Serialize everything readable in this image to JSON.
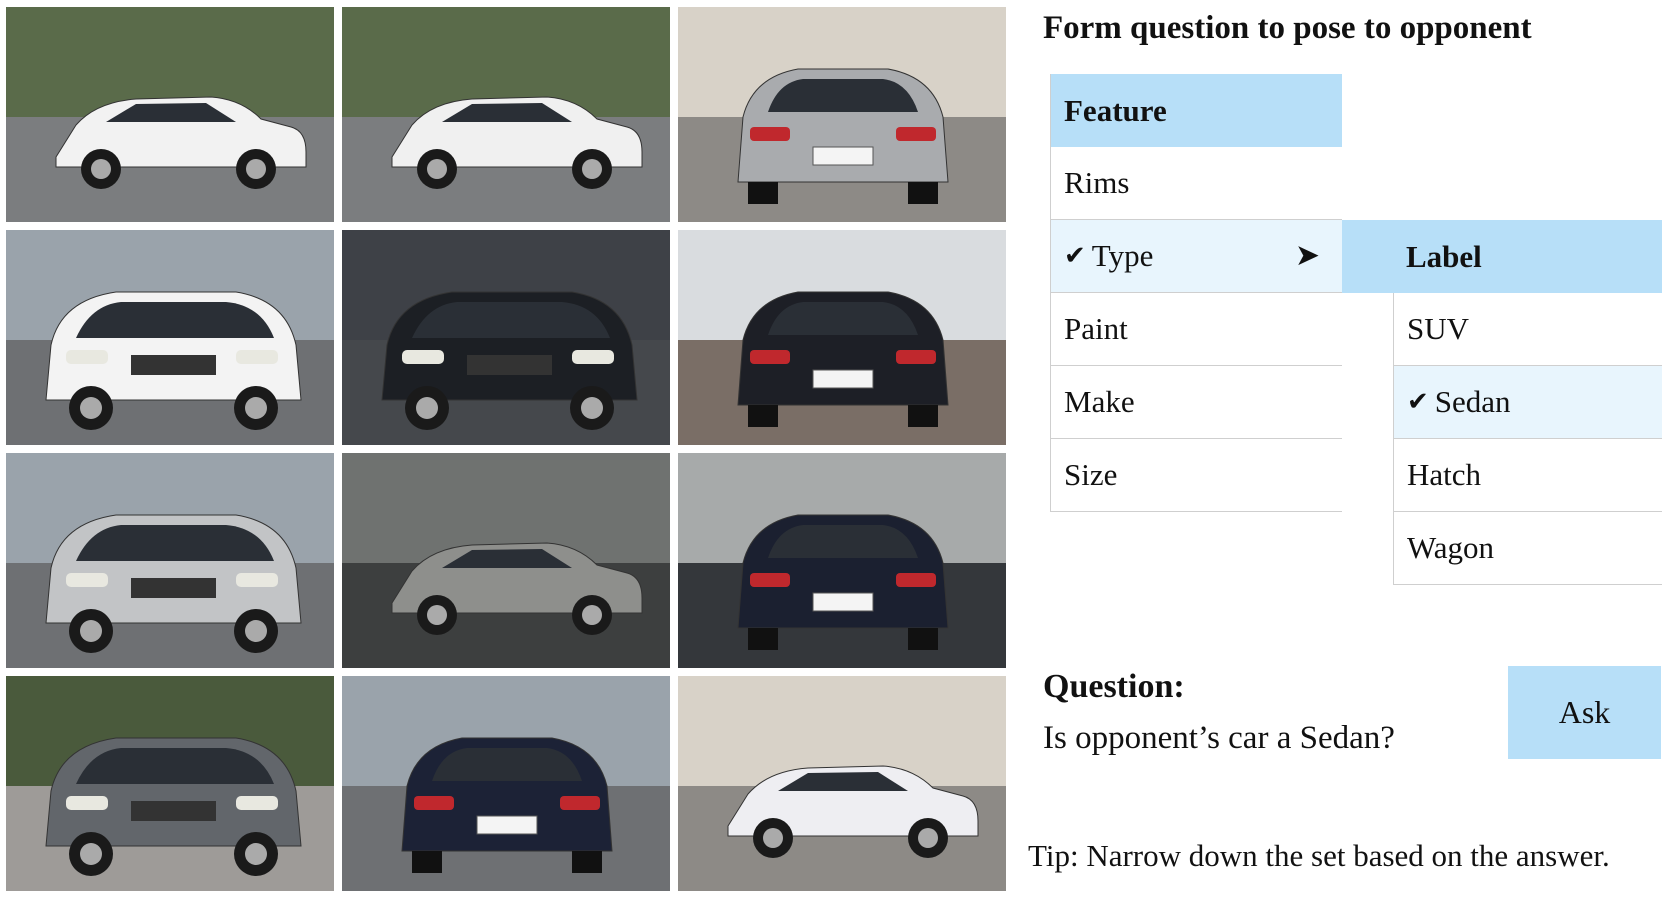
{
  "form_title": "Form question to pose to opponent",
  "feature_table": {
    "header": "Feature",
    "rows": [
      {
        "label": "Rims",
        "selected": false
      },
      {
        "label": "Type",
        "selected": true,
        "check": "✔",
        "arrow": "➤"
      },
      {
        "label": "Paint",
        "selected": false
      },
      {
        "label": "Make",
        "selected": false
      },
      {
        "label": "Size",
        "selected": false
      }
    ]
  },
  "label_table": {
    "header": "Label",
    "rows": [
      {
        "label": "SUV",
        "selected": false
      },
      {
        "label": "Sedan",
        "selected": true,
        "check": "✔"
      },
      {
        "label": "Hatch",
        "selected": false
      },
      {
        "label": "Wagon",
        "selected": false
      }
    ]
  },
  "question": {
    "title": "Question:",
    "text": "Is opponent’s car a Sedan?"
  },
  "ask_button": "Ask",
  "tip": "Tip: Narrow down the set based on the answer.",
  "colors": {
    "header_bg": "#b7dff8",
    "selected_bg": "#e8f5fd"
  },
  "car_grid": [
    {
      "name": "white-hatchback",
      "color": "#f2f2f2",
      "scene": "road-blur",
      "view": "side"
    },
    {
      "name": "white-convertible",
      "color": "#f0f0f0",
      "scene": "road-blur",
      "view": "side"
    },
    {
      "name": "silver-suv-rear",
      "color": "#a9abae",
      "scene": "building",
      "view": "rear"
    },
    {
      "name": "white-suv",
      "color": "#f3f3f3",
      "scene": "street",
      "view": "front"
    },
    {
      "name": "black-sedan",
      "color": "#1c1f24",
      "scene": "dark",
      "view": "front"
    },
    {
      "name": "black-crossover-rear",
      "color": "#1d1f26",
      "scene": "garage",
      "view": "rear"
    },
    {
      "name": "silver-compact-suv",
      "color": "#c2c4c6",
      "scene": "street",
      "view": "front"
    },
    {
      "name": "silver-sedan",
      "color": "#8e8f8c",
      "scene": "road-gray",
      "view": "side"
    },
    {
      "name": "dark-sedan-rear",
      "color": "#1b2030",
      "scene": "road-dark",
      "view": "rear"
    },
    {
      "name": "gray-crossover",
      "color": "#62666b",
      "scene": "trees",
      "view": "front"
    },
    {
      "name": "dark-sedan-back",
      "color": "#1c2236",
      "scene": "street",
      "view": "rear"
    },
    {
      "name": "white-wagon",
      "color": "#eeeef2",
      "scene": "building",
      "view": "side"
    }
  ]
}
